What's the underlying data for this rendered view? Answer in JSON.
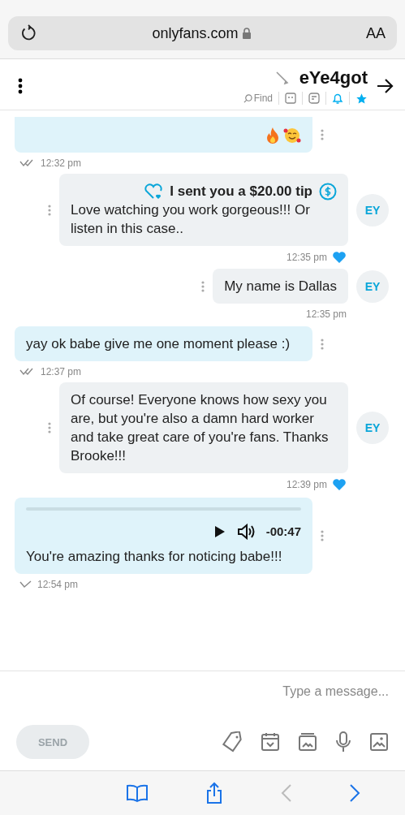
{
  "browser": {
    "text_size": "AA",
    "url": "onlyfans.com"
  },
  "header": {
    "name": "eYe4got",
    "find": "Find"
  },
  "messages": [
    {
      "kind": "emoji",
      "time": "12:32 pm",
      "read": true
    },
    {
      "kind": "tip",
      "avatar": "EY",
      "tip": "I sent you a $20.00 tip",
      "text": "Love watching you work gorgeous!!! Or listen in this case..",
      "time": "12:35 pm",
      "liked": true
    },
    {
      "kind": "text",
      "avatar": "EY",
      "text": "My name is Dallas",
      "time": "12:35 pm",
      "liked": false
    },
    {
      "kind": "text",
      "text": "yay ok babe give me one moment please :)",
      "time": "12:37 pm",
      "read": true
    },
    {
      "kind": "text",
      "avatar": "EY",
      "text": "Of course! Everyone knows how sexy you are, but you're also a damn hard worker and take great care of you're fans. Thanks Brooke!!!",
      "time": "12:39 pm",
      "liked": true
    },
    {
      "kind": "audio",
      "duration": "-00:47",
      "text": "You're amazing thanks for noticing babe!!!",
      "time": "12:54 pm",
      "read": false
    }
  ],
  "composer": {
    "placeholder": "Type a message...",
    "send": "SEND",
    "send_disabled": true
  }
}
